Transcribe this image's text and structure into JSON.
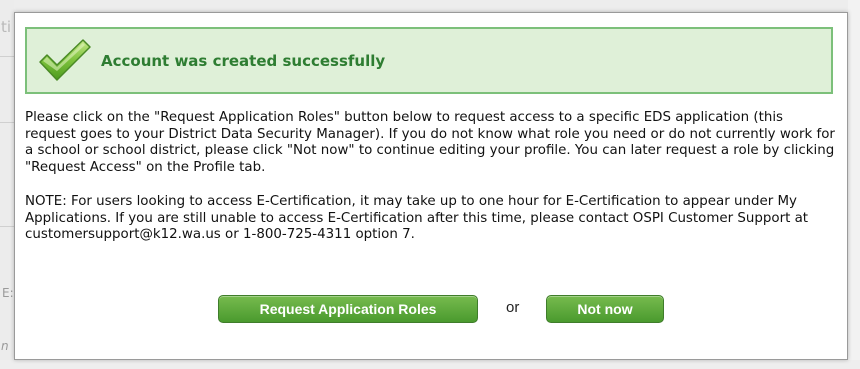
{
  "background": {
    "left_fragment_top": "ti",
    "left_fragment_mid": "E:",
    "left_fragment_bottom": "n"
  },
  "dialog": {
    "banner": {
      "icon": "checkmark-icon",
      "message": "Account was created successfully",
      "colors": {
        "background": "#dff0d8",
        "border": "#7cc07a",
        "text": "#2e7d32"
      }
    },
    "paragraph1": "Please click on the \"Request Application Roles\" button below to request access to a specific EDS application (this request goes to your District Data Security Manager). If you do not know what role you need or do not currently work for a school or school district, please click \"Not now\" to continue editing your profile. You can later request a role by clicking \"Request Access\" on the Profile tab.",
    "paragraph2": "NOTE: For users looking to access E-Certification, it may take up to one hour for E-Certification to appear under My Applications. If you are still unable to access E-Certification after this time, please contact OSPI Customer Support at customersupport@k12.wa.us or 1-800-725-4311 option 7.",
    "buttons": {
      "request_label": "Request Application Roles",
      "or_label": "or",
      "not_now_label": "Not now",
      "accent": "#5aa83a"
    }
  }
}
